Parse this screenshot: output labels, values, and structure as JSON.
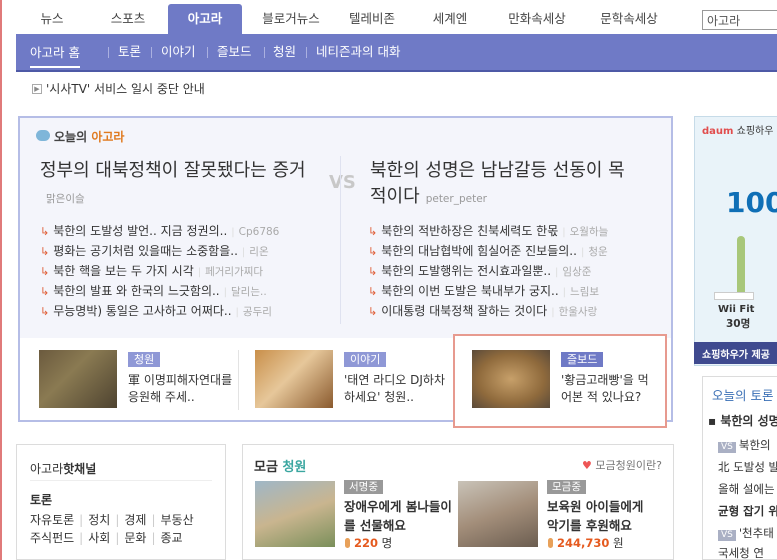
{
  "nav": {
    "tabs": [
      {
        "label": "뉴스"
      },
      {
        "label": "스포츠"
      },
      {
        "label": "아고라",
        "active": true
      },
      {
        "label": "블로거뉴스"
      },
      {
        "label": "텔레비존"
      },
      {
        "label": "세계엔"
      },
      {
        "label": "만화속세상"
      },
      {
        "label": "문학속세상"
      }
    ],
    "search_value": "아고라"
  },
  "subnav": {
    "items": [
      "아고라 홈",
      "토론",
      "이야기",
      "즐보드",
      "청원",
      "네티즌과의 대화"
    ]
  },
  "notice": {
    "text": "'시사TV' 서비스 일시 중단 안내"
  },
  "today": {
    "title_prefix": "오늘의",
    "title_highlight": "아고라",
    "vs": "VS",
    "left": {
      "headline": "정부의 대북정책이 잘못됐다는 증거",
      "author": "맑은이슬",
      "links": [
        {
          "text": "북한의 도발성 발언.. 지금 정권의..",
          "by": "Cp6786"
        },
        {
          "text": "평화는 공기처럼 있을때는 소중함을..",
          "by": "리온"
        },
        {
          "text": "북한 핵을 보는 두 가지 시각",
          "by": "페거리가찌다"
        },
        {
          "text": "북한의 발표 와 한국의 느긋함의..",
          "by": "달리는.."
        },
        {
          "text": "무능명박) 통일은 고사하고 어쩌다..",
          "by": "공두리"
        }
      ]
    },
    "right": {
      "headline": "북한의 성명은 남남갈등 선동이 목적이다",
      "author": "peter_peter",
      "links": [
        {
          "text": "북한의 적반하장은 친북세력도 한몫",
          "by": "오월하늘"
        },
        {
          "text": "북한의 대남협박에 힘실어준 진보들의..",
          "by": "청운"
        },
        {
          "text": "북한의 도발행위는 전시효과일뿐..",
          "by": "임상준"
        },
        {
          "text": "북한의 이번 도발은 북내부가 궁지..",
          "by": "느림보"
        },
        {
          "text": "이대통령 대북정책 잘하는 것이다",
          "by": "한울사랑"
        }
      ]
    },
    "cards": [
      {
        "tag": "청원",
        "text": "軍 이명피해자연대를 응원해 주세.."
      },
      {
        "tag": "이야기",
        "text": "'태연 라디오 DJ하차하세요' 청원.."
      },
      {
        "tag": "즐보드",
        "text": "'황금고래빵'을 먹어본 적 있나요?"
      }
    ]
  },
  "channel": {
    "title_prefix": "아고라",
    "title_bold": "핫채널",
    "toron_head": "토론",
    "row1": [
      "자유토론",
      "정치",
      "경제",
      "부동산"
    ],
    "row2": [
      "주식펀드",
      "사회",
      "문화",
      "종교"
    ]
  },
  "moim": {
    "title_prefix": "모금",
    "title_highlight": "청원",
    "link": "모금청원이란?",
    "items": [
      {
        "tag": "서명중",
        "text": "장애우에게 봄나들이를 선물해요",
        "count": "220",
        "unit": "명"
      },
      {
        "tag": "모금중",
        "text": "보육원 아이들에게 악기를 후원해요",
        "count": "244,730",
        "unit": "원"
      }
    ]
  },
  "right": {
    "ad_brand": "쇼핑하우",
    "ad_big": "100",
    "ad_product": "Wii Fit",
    "ad_days": "30명",
    "ad_caption": "쇼핑하우가 제공",
    "toron_title": "오늘의 토론",
    "toron_head": "북한의 성명",
    "items": [
      {
        "vs": "VS",
        "text": "북한의"
      },
      {
        "vs": "",
        "text": "北 도발성 발"
      },
      {
        "vs": "",
        "text": "올해 설에는"
      },
      {
        "vs": "",
        "text": "균형 잡기 위"
      },
      {
        "vs": "VS",
        "text": "'천추태"
      },
      {
        "vs": "",
        "text": "국세청 연"
      }
    ]
  },
  "colors": {
    "nav_accent": "#6f7ac6",
    "highlight_orange": "#e07a1f",
    "arrow_red": "#e0603a",
    "selection_border": "#e79a8f"
  }
}
